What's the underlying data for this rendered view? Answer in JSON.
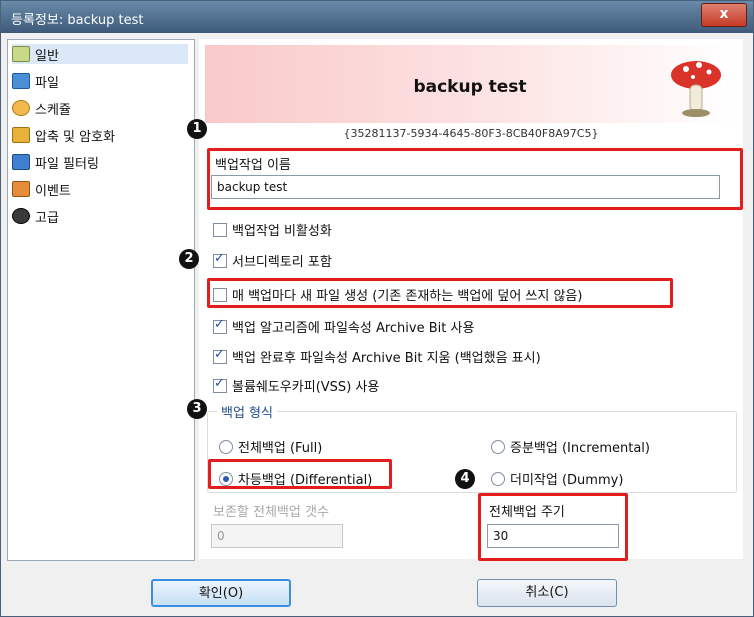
{
  "window": {
    "title": "등록정보: backup test",
    "close_label": "x"
  },
  "sidebar": {
    "items": [
      {
        "label": "일반",
        "icon": "general-icon"
      },
      {
        "label": "파일",
        "icon": "files-icon"
      },
      {
        "label": "스케쥴",
        "icon": "schedule-icon"
      },
      {
        "label": "압축 및 암호화",
        "icon": "compression-icon"
      },
      {
        "label": "파일 필터링",
        "icon": "filter-icon"
      },
      {
        "label": "이벤트",
        "icon": "event-icon"
      },
      {
        "label": "고급",
        "icon": "advanced-icon"
      }
    ]
  },
  "header": {
    "title": "backup test",
    "guid": "{35281137-5934-4645-80F3-8CB40F8A97C5}"
  },
  "job_name": {
    "label": "백업작업 이름",
    "value": "backup test"
  },
  "options": {
    "disable": "백업작업 비활성화",
    "subdirs": "서브디렉토리 포함",
    "new_file": "매 백업마다 새 파일 생성 (기존 존재하는 백업에 덮어 쓰지 않음)",
    "archive_bit": "백업 알고리즘에 파일속성 Archive Bit 사용",
    "clear_bit": "백업 완료후 파일속성 Archive Bit 지움 (백업했음 표시)",
    "vss": "볼륨쉐도우카피(VSS) 사용"
  },
  "backup_type": {
    "label": "백업 형식",
    "full": "전체백업 (Full)",
    "incremental": "증분백업 (Incremental)",
    "differential": "차등백업 (Differential)",
    "dummy": "더미작업 (Dummy)"
  },
  "keep_full": {
    "label": "보존할 전체백업 갯수",
    "value": "0"
  },
  "full_cycle": {
    "label": "전체백업 주기",
    "value": "30"
  },
  "markers": [
    "1",
    "2",
    "3",
    "4"
  ],
  "buttons": {
    "ok": "확인(O)",
    "cancel": "취소(C)"
  },
  "colors": {
    "highlight": "#e31c1c",
    "selected_bg": "#dbe8f8"
  }
}
